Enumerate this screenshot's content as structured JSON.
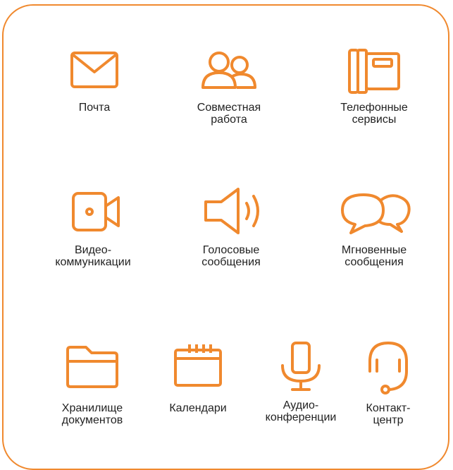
{
  "accent_color": "#F0892E",
  "services": [
    {
      "icon": "envelope-icon",
      "lines": [
        "Почта"
      ]
    },
    {
      "icon": "users-icon",
      "lines": [
        "Совместная",
        "работа"
      ]
    },
    {
      "icon": "desk-phone-icon",
      "lines": [
        "Телефонные",
        "сервисы"
      ]
    },
    {
      "icon": "video-camera-icon",
      "lines": [
        "Видео-",
        "коммуникации"
      ]
    },
    {
      "icon": "speaker-icon",
      "lines": [
        "Голосовые",
        "сообщения"
      ]
    },
    {
      "icon": "chat-bubbles-icon",
      "lines": [
        "Мгновенные",
        "сообщения"
      ]
    },
    {
      "icon": "folder-icon",
      "lines": [
        "Хранилище",
        "документов"
      ]
    },
    {
      "icon": "calendar-icon",
      "lines": [
        "Календари"
      ]
    },
    {
      "icon": "microphone-icon",
      "lines": [
        "Аудио-",
        "конференции"
      ]
    },
    {
      "icon": "headset-icon",
      "lines": [
        "Контакт-",
        "центр"
      ]
    }
  ]
}
